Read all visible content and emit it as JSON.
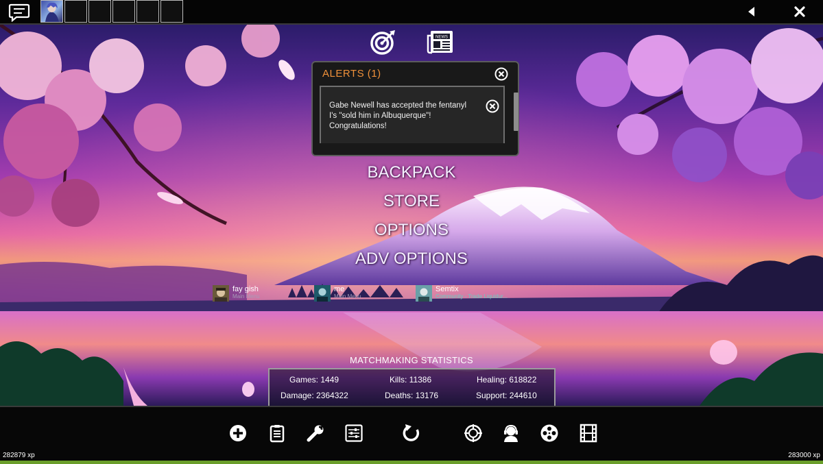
{
  "topbar": {
    "chat_icon": "chat-bubble-icon",
    "party_slots": [
      {
        "filled": true
      },
      {
        "filled": false
      },
      {
        "filled": false
      },
      {
        "filled": false
      },
      {
        "filled": false
      },
      {
        "filled": false
      }
    ],
    "back_icon": "triangle-left-icon",
    "close_icon": "close-x-icon"
  },
  "header_icons": [
    "target-icon",
    "news-icon"
  ],
  "news_badge": "NEWS",
  "alerts": {
    "title": "ALERTS (1)",
    "items": [
      {
        "text": "Gabe Newell has accepted the fentanyl I's \"sold him in Albuquerque\"! Congratulations!"
      }
    ]
  },
  "menu": {
    "backpack": "BACKPACK",
    "store": "STORE",
    "options": "OPTIONS",
    "adv_options": "ADV OPTIONS"
  },
  "friends": [
    {
      "name": "fay gish",
      "status": "Main Menu"
    },
    {
      "name": "me",
      "status": "Main Menu"
    },
    {
      "name": "Semtix",
      "status": "Community - Trade Liquidur..."
    }
  ],
  "stats": {
    "title": "MATCHMAKING STATISTICS",
    "games": "Games: 1449",
    "kills": "Kills: 11386",
    "healing": "Healing: 618822",
    "damage": "Damage: 2364322",
    "deaths": "Deaths: 13176",
    "support": "Support: 244610"
  },
  "bottombar": {
    "buttons": [
      "plus-circle-icon",
      "clipboard-icon",
      "wrench-icon",
      "sliders-icon",
      "refresh-icon",
      "crosshair-icon",
      "headset-support-icon",
      "film-reel-icon",
      "film-strip-icon"
    ],
    "xp_current": "282879 xp",
    "xp_next": "283000 xp",
    "xp_progress": 0.9996
  },
  "colors": {
    "alert_title": "#f0913a",
    "community_status": "#62d0c4",
    "xp_bar": "#6a9e2a"
  }
}
